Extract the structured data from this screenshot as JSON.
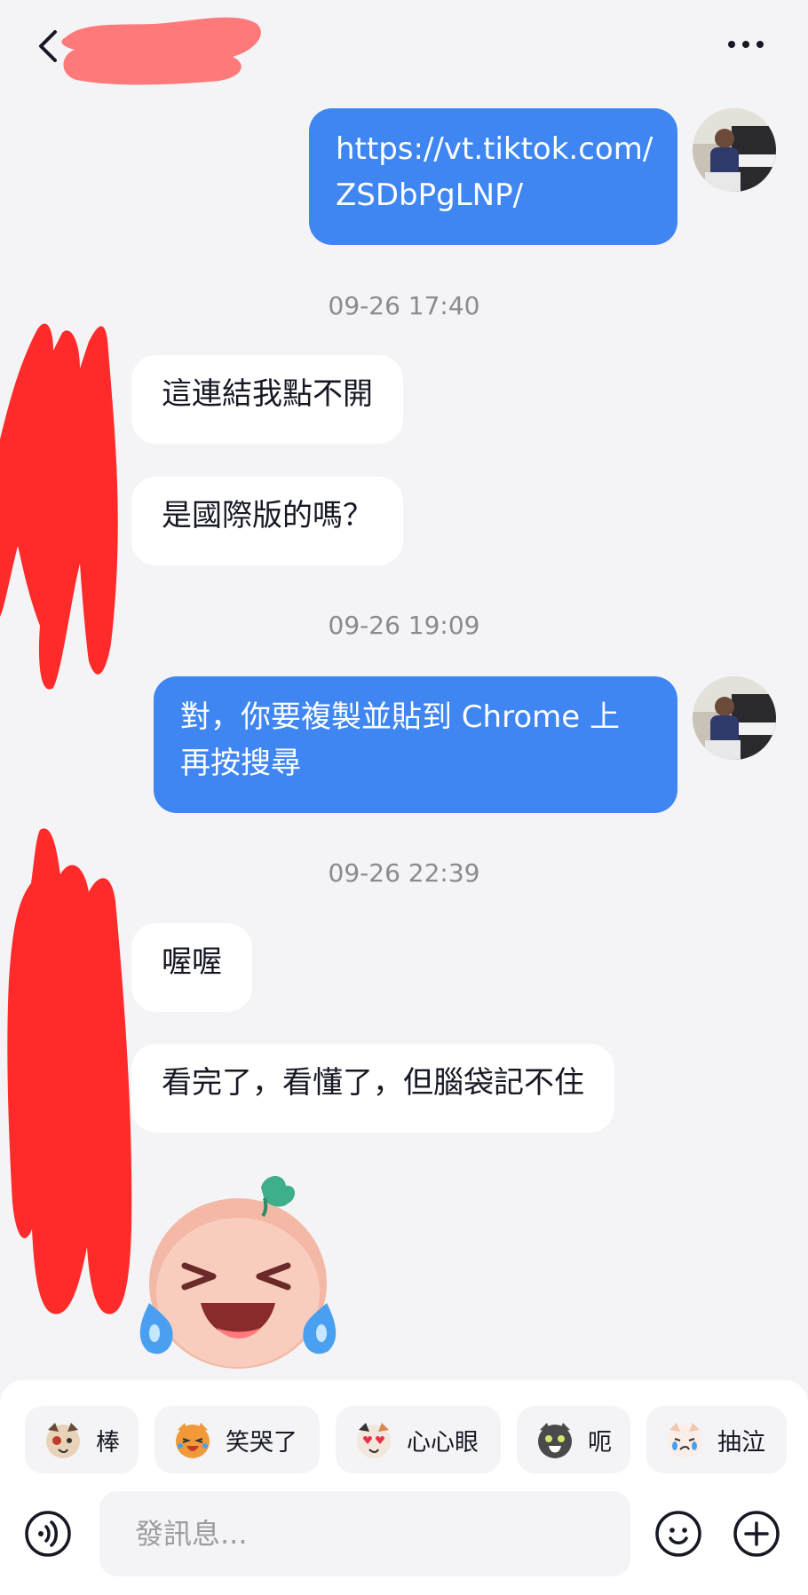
{
  "header": {
    "back_icon": "chevron-left-icon",
    "more_icon": "more-dots-icon"
  },
  "messages": [
    {
      "side": "out",
      "lines": [
        "https://vt.tiktok.com/",
        "ZSDbPgLNP/"
      ]
    },
    {
      "timestamp": "09-26 17:40"
    },
    {
      "side": "in",
      "text": "這連結我點不開"
    },
    {
      "side": "in",
      "text": "是國際版的嗎？"
    },
    {
      "timestamp": "09-26 19:09"
    },
    {
      "side": "out",
      "lines": [
        "對，你要複製並貼到 Chrome 上",
        "再按搜尋"
      ]
    },
    {
      "timestamp": "09-26 22:39"
    },
    {
      "side": "in",
      "text": "喔喔"
    },
    {
      "side": "in",
      "text": "看完了，看懂了，但腦袋記不住"
    }
  ],
  "quick_replies": [
    "棒",
    "笑哭了",
    "心心眼",
    "呃",
    "抽泣"
  ],
  "composer": {
    "placeholder": "發訊息..."
  },
  "colors": {
    "outgoing_bubble": "#3f86f2",
    "incoming_bubble": "#ffffff",
    "background": "#f4f4f6",
    "redaction": "#ff2b2b"
  }
}
